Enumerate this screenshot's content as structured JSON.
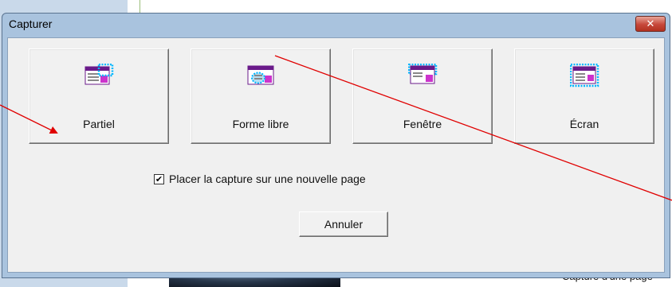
{
  "window": {
    "title": "Capturer",
    "close_icon": "close-icon"
  },
  "capture_modes": [
    {
      "label": "Partiel",
      "icon": "partial-capture-icon"
    },
    {
      "label": "Forme libre",
      "icon": "freeform-capture-icon"
    },
    {
      "label": "Fenêtre",
      "icon": "window-capture-icon"
    },
    {
      "label": "Écran",
      "icon": "screen-capture-icon"
    }
  ],
  "options": {
    "new_page_label": "Placer la capture sur une nouvelle page",
    "new_page_checked": true
  },
  "actions": {
    "cancel_label": "Annuler"
  },
  "background": {
    "caption_fragment": "Capture d'une page"
  },
  "colors": {
    "annotation_arrow": "#e00000",
    "selection_dots": "#00b7ff",
    "icon_accent": "#cc33cc",
    "icon_header": "#6a1a8a"
  }
}
